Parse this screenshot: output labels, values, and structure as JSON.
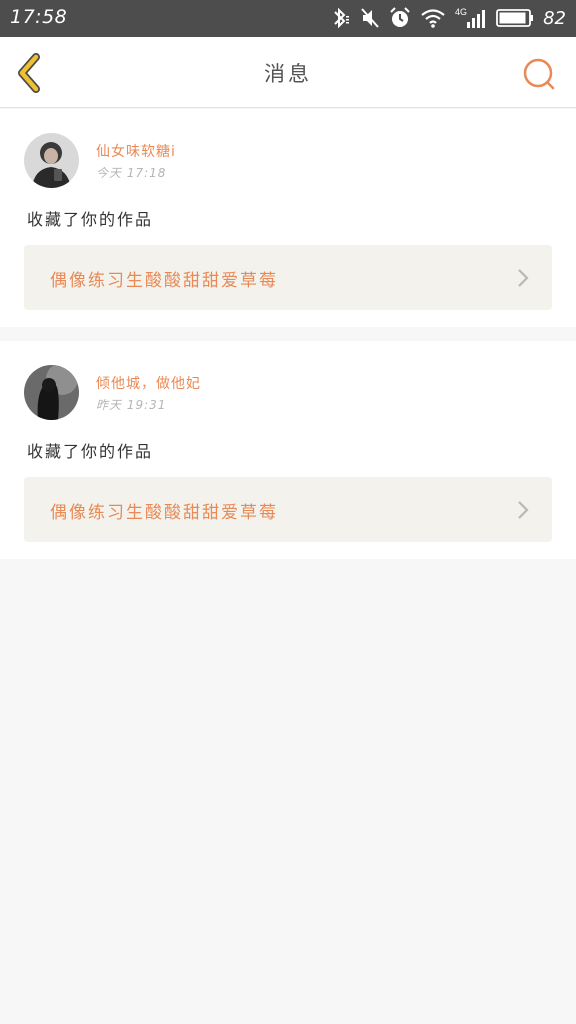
{
  "status_bar": {
    "time": "17:58",
    "battery": "82",
    "network": "4G"
  },
  "nav": {
    "title": "消息"
  },
  "messages": [
    {
      "username": "仙女味软糖i",
      "time": "今天 17:18",
      "action": "收藏了你的作品",
      "work_title": "偶像练习生酸酸甜甜爱草莓"
    },
    {
      "username": "倾他城，做他妃",
      "time": "昨天 19:31",
      "action": "收藏了你的作品",
      "work_title": "偶像练习生酸酸甜甜爱草莓"
    }
  ],
  "colors": {
    "accent": "#e98a56",
    "back_arrow": "#f0c030",
    "status_bar": "#4d4d4d",
    "card_inner": "#f3f2ed"
  }
}
